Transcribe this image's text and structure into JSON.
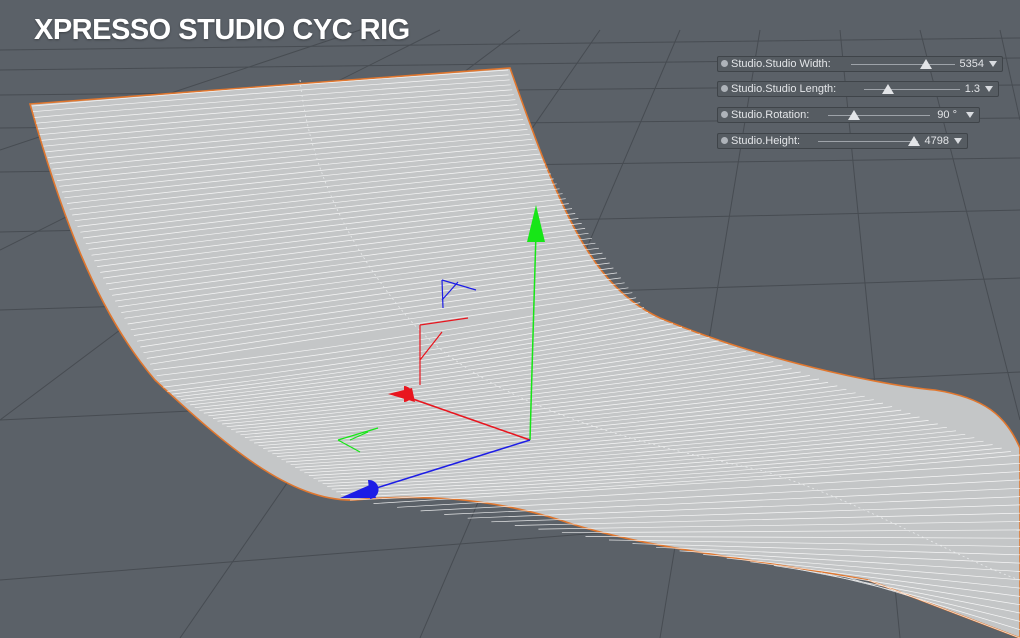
{
  "title": "XPRESSO STUDIO CYC RIG",
  "params": [
    {
      "label": "Studio.Studio Width:",
      "value": "5354",
      "fraction": 0.72
    },
    {
      "label": "Studio.Studio Length:",
      "value": "1.3",
      "fraction": 0.25
    },
    {
      "label": "Studio.Rotation:",
      "value": "90 °",
      "fraction": 0.25
    },
    {
      "label": "Studio.Height:",
      "value": "4798",
      "fraction": 0.96
    }
  ],
  "icons": {
    "bullet": "circle-bullet-icon",
    "knob": "slider-knob-icon",
    "dropdown": "triangle-down-icon"
  },
  "colors": {
    "background": "#5b6168",
    "surface": "#c4c6c7",
    "mesh_lines": "#ffffff",
    "edge": "#e0772f",
    "axis_x": "#e8151e",
    "axis_y": "#17e617",
    "axis_z": "#1d1de6"
  }
}
